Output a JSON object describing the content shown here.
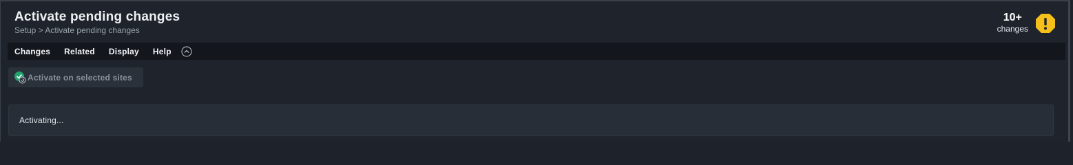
{
  "header": {
    "title": "Activate pending changes",
    "breadcrumb": "Setup > Activate pending changes"
  },
  "changes_indicator": {
    "count": "10+",
    "label": "changes",
    "icon": "warning-icon",
    "icon_color": "#f5c01a"
  },
  "menu": {
    "items": [
      {
        "label": "Changes"
      },
      {
        "label": "Related"
      },
      {
        "label": "Display"
      },
      {
        "label": "Help"
      }
    ],
    "collapse_icon": "chevron-up-circle-icon"
  },
  "actions": {
    "activate_label": "Activate on selected sites",
    "activate_icon": "activate-sites-icon",
    "activate_icon_color": "#23a26d"
  },
  "status": {
    "text": "Activating..."
  }
}
